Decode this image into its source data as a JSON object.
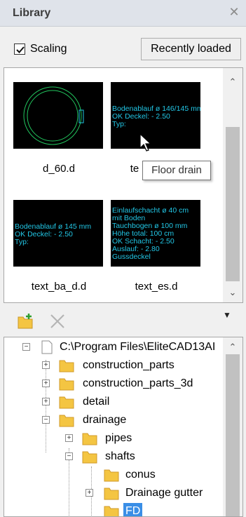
{
  "panel": {
    "title": "Library"
  },
  "options": {
    "scaling_label": "Scaling",
    "scaling_checked": true,
    "recent_button": "Recently loaded"
  },
  "thumbnails": [
    {
      "name": "d_60.d",
      "lines": []
    },
    {
      "name": "te",
      "lines": [
        "Bodenablauf ø 146/145 mm",
        "OK Deckel: - 2.50",
        "Typ:"
      ]
    },
    {
      "name": "text_ba_d.d",
      "lines": [
        "Bodenablauf ø 145 mm",
        "OK Deckel: - 2.50",
        "Typ:"
      ]
    },
    {
      "name": "text_es.d",
      "lines": [
        "Einlaufschacht ø 40 cm",
        "mit Boden",
        "Tauchbogen ø 100 mm",
        "Höhe total: 100 cm",
        "OK Schacht: - 2.50",
        "Auslauf: - 2.80",
        "Gussdeckel"
      ]
    }
  ],
  "tooltip": "Floor drain",
  "tree": {
    "root": "C:\\Program Files\\EliteCAD13AI",
    "items": [
      {
        "label": "construction_parts"
      },
      {
        "label": "construction_parts_3d"
      },
      {
        "label": "detail"
      },
      {
        "label": "drainage"
      },
      {
        "label": "pipes"
      },
      {
        "label": "shafts"
      },
      {
        "label": "conus"
      },
      {
        "label": "Drainage gutter"
      },
      {
        "label": "FD"
      }
    ]
  },
  "colors": {
    "cad_text": "#22c7e6",
    "cad_circle": "#22c55e",
    "selection": "#3a8ee6",
    "folder": "#f4c542"
  }
}
